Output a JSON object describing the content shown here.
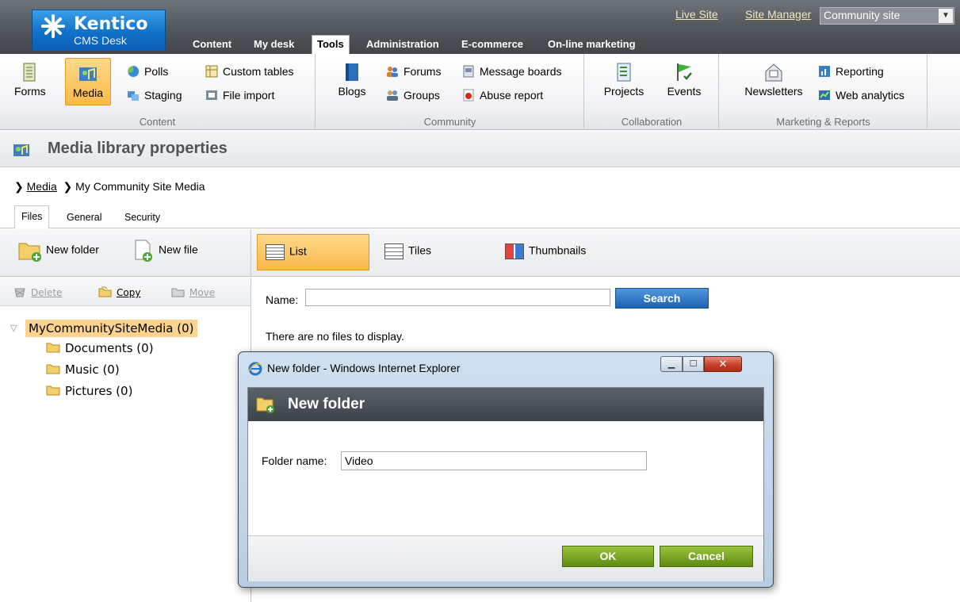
{
  "logo": {
    "name": "Kentico",
    "subtitle": "CMS Desk"
  },
  "top_links": {
    "live_site": "Live Site",
    "site_manager": "Site Manager"
  },
  "site_selector": {
    "value": "Community site"
  },
  "main_tabs": [
    "Content",
    "My desk",
    "Tools",
    "Administration",
    "E-commerce",
    "On-line marketing"
  ],
  "active_main_tab": "Tools",
  "ribbon": {
    "content": {
      "label": "Content",
      "forms": "Forms",
      "media": "Media",
      "polls": "Polls",
      "staging": "Staging",
      "custom_tables": "Custom tables",
      "file_import": "File import"
    },
    "community": {
      "label": "Community",
      "blogs": "Blogs",
      "forums": "Forums",
      "groups": "Groups",
      "message_boards": "Message boards",
      "abuse_report": "Abuse report"
    },
    "collaboration": {
      "label": "Collaboration",
      "projects": "Projects",
      "events": "Events"
    },
    "marketing": {
      "label": "Marketing & Reports",
      "newsletters": "Newsletters",
      "reporting": "Reporting",
      "web_analytics": "Web analytics"
    }
  },
  "page": {
    "title": "Media library properties",
    "breadcrumb": {
      "link": "Media",
      "current": "My Community Site Media"
    },
    "tabs": [
      "Files",
      "General",
      "Security"
    ]
  },
  "toolbar": {
    "new_folder": "New folder",
    "new_file": "New file",
    "views": {
      "list": "List",
      "tiles": "Tiles",
      "thumbnails": "Thumbnails"
    },
    "active_view": "List"
  },
  "tree": {
    "actions": {
      "delete": "Delete",
      "copy": "Copy",
      "move": "Move"
    },
    "root": "MyCommunitySiteMedia (0)",
    "children": [
      "Documents (0)",
      "Music (0)",
      "Pictures (0)"
    ]
  },
  "search": {
    "name_label": "Name:",
    "name_value": "",
    "button": "Search"
  },
  "empty_message": "There are no files to display.",
  "dialog": {
    "window_title": "New folder - Windows Internet Explorer",
    "header": "New folder",
    "folder_name_label": "Folder name:",
    "folder_name_value": "Video",
    "ok": "OK",
    "cancel": "Cancel"
  }
}
